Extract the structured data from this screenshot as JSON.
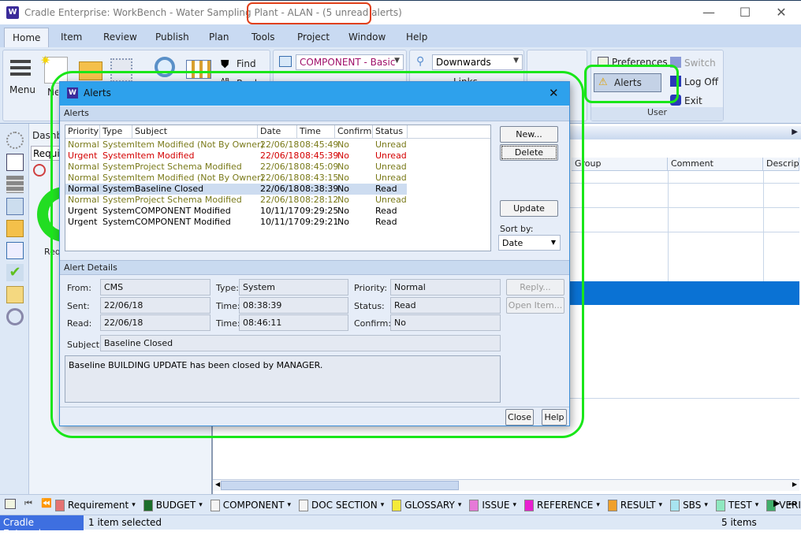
{
  "window": {
    "title": "Cradle Enterprise: WorkBench - Water Sampling Plant - ALAN - (5 unread alerts)",
    "app_icon_letter": "W",
    "minimize": "—",
    "maximize": "☐",
    "close": "✕"
  },
  "menu_tabs": [
    "Home",
    "Item",
    "Review",
    "Publish",
    "Plan",
    "Tools",
    "Project",
    "Window",
    "Help"
  ],
  "ribbon": {
    "menu_label": "Menu",
    "new_item_label": "New Item",
    "find_label": "Find",
    "replace_label": "Replace",
    "view_combo": "COMPONENT - Basic",
    "direction_combo": "Downwards",
    "links_label": "Links",
    "preferences_label": "Preferences",
    "switch_label": "Switch",
    "alerts_label": "Alerts",
    "logoff_label": "Log Off",
    "exit_label": "Exit",
    "user_group_label": "User"
  },
  "dashboard": {
    "title": "Dashb",
    "tab": "Requi",
    "chart_label": "Req"
  },
  "grid": {
    "columns": [
      "Group",
      "Comment",
      "Descript"
    ]
  },
  "dialog": {
    "title": "Alerts",
    "icon_letter": "W",
    "close": "✕",
    "alerts_section": "Alerts",
    "columns": [
      "Priority",
      "Type",
      "Subject",
      "Date",
      "Time",
      "Confirm",
      "Status"
    ],
    "rows": [
      {
        "priority": "Normal",
        "type": "System",
        "subject": "Item Modified (Not By Owner)",
        "date": "22/06/18",
        "time": "08:45:49",
        "confirm": "No",
        "status": "Unread",
        "style": "unread"
      },
      {
        "priority": "Urgent",
        "type": "System",
        "subject": "Item Modified",
        "date": "22/06/18",
        "time": "08:45:39",
        "confirm": "No",
        "status": "Unread",
        "style": "urgent"
      },
      {
        "priority": "Normal",
        "type": "System",
        "subject": "Project Schema Modified",
        "date": "22/06/18",
        "time": "08:45:09",
        "confirm": "No",
        "status": "Unread",
        "style": "unread"
      },
      {
        "priority": "Normal",
        "type": "System",
        "subject": "Item Modified (Not By Owner)",
        "date": "22/06/18",
        "time": "08:43:15",
        "confirm": "No",
        "status": "Unread",
        "style": "unread"
      },
      {
        "priority": "Normal",
        "type": "System",
        "subject": "Baseline Closed",
        "date": "22/06/18",
        "time": "08:38:39",
        "confirm": "No",
        "status": "Read",
        "style": "selected"
      },
      {
        "priority": "Normal",
        "type": "System",
        "subject": "Project Schema Modified",
        "date": "22/06/18",
        "time": "08:28:12",
        "confirm": "No",
        "status": "Unread",
        "style": "unread"
      },
      {
        "priority": "Urgent",
        "type": "System",
        "subject": "COMPONENT Modified",
        "date": "10/11/17",
        "time": "09:29:25",
        "confirm": "No",
        "status": "Read",
        "style": "read"
      },
      {
        "priority": "Urgent",
        "type": "System",
        "subject": "COMPONENT Modified",
        "date": "10/11/17",
        "time": "09:29:21",
        "confirm": "No",
        "status": "Read",
        "style": "read"
      }
    ],
    "buttons": {
      "new": "New...",
      "delete": "Delete",
      "update": "Update",
      "reply": "Reply...",
      "open_item": "Open Item...",
      "close": "Close",
      "help": "Help"
    },
    "sort_by_label": "Sort by:",
    "sort_by_value": "Date",
    "details_section": "Alert Details",
    "details": {
      "from_label": "From:",
      "from": "CMS",
      "type_label": "Type:",
      "type": "System",
      "priority_label": "Priority:",
      "priority": "Normal",
      "sent_label": "Sent:",
      "sent": "22/06/18",
      "sent_time_label": "Time:",
      "sent_time": "08:38:39",
      "status_label": "Status:",
      "status": "Read",
      "read_label": "Read:",
      "read": "22/06/18",
      "read_time_label": "Time:",
      "read_time": "08:46:11",
      "confirm_label": "Confirm:",
      "confirm": "No",
      "subject_label": "Subject:",
      "subject": "Baseline Closed",
      "body": "Baseline BUILDING UPDATE  has been closed by MANAGER."
    }
  },
  "bottom_toolbar": {
    "items": [
      {
        "label": "Requirement",
        "color": "#e57373"
      },
      {
        "label": "BUDGET",
        "color": "#1b6e2a"
      },
      {
        "label": "COMPONENT",
        "color": "#f4f4f4"
      },
      {
        "label": "DOC SECTION",
        "color": "#f4f4f4"
      },
      {
        "label": "GLOSSARY",
        "color": "#f5ea3a"
      },
      {
        "label": "ISSUE",
        "color": "#e67ad8"
      },
      {
        "label": "REFERENCE",
        "color": "#e81fd0"
      },
      {
        "label": "RESULT",
        "color": "#f0a02a"
      },
      {
        "label": "SBS",
        "color": "#a8e4f0"
      },
      {
        "label": "TEST",
        "color": "#8fe8c0"
      },
      {
        "label": "VERIFICAT",
        "color": "#3fae6a"
      }
    ]
  },
  "statusbar": {
    "app": "Cradle Enterprise",
    "selection": "1 item selected",
    "count": "5 items"
  },
  "colors": {
    "urgent": "#d40000",
    "unread": "#7a7a1a",
    "read": "#000000",
    "annotation_green": "#19e619",
    "annotation_red": "#e0401a"
  }
}
